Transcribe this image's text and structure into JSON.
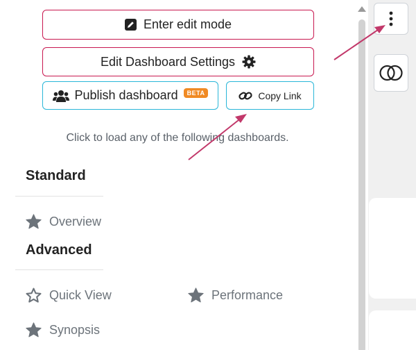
{
  "menu": {
    "edit_mode_label": "Enter edit mode",
    "settings_label": "Edit Dashboard Settings",
    "publish_label": "Publish dashboard",
    "publish_badge": "BETA",
    "copy_link_label": "Copy Link"
  },
  "hint": "Click to load any of the following dashboards.",
  "sections": {
    "standard": {
      "title": "Standard",
      "items": [
        {
          "label": "Overview",
          "icon": "star-filled-icon"
        }
      ]
    },
    "advanced": {
      "title": "Advanced",
      "items": [
        {
          "label": "Quick View",
          "icon": "star-outline-icon"
        },
        {
          "label": "Performance",
          "icon": "star-filled-icon"
        },
        {
          "label": "Synopsis",
          "icon": "star-filled-icon"
        }
      ]
    }
  },
  "colors": {
    "pink_border": "#c8174f",
    "cyan_border": "#29b6d8",
    "badge": "#f08a24",
    "annotation_arrow": "#c2386a"
  }
}
